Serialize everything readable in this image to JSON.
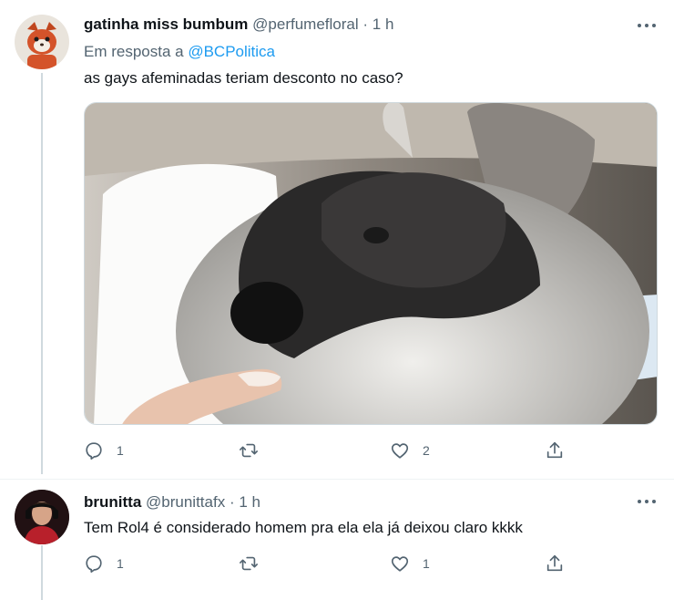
{
  "tweets": [
    {
      "display_name": "gatinha miss bumbum",
      "handle": "@perfumefloral",
      "separator": "·",
      "time": "1 h",
      "replying_prefix": "Em resposta a ",
      "replying_to": "@BCPolitica",
      "text": "as gays afeminadas teriam desconto no caso?",
      "has_media": true,
      "actions": {
        "reply_count": "1",
        "retweet_count": "",
        "like_count": "2"
      }
    },
    {
      "display_name": "brunitta",
      "handle": "@brunittafx",
      "separator": "·",
      "time": "1 h",
      "text": "Tem Rol4 é considerado homem pra ela ela já deixou claro kkkk",
      "actions": {
        "reply_count": "1",
        "retweet_count": "",
        "like_count": "1"
      }
    }
  ],
  "colors": {
    "accent": "#1d9bf0",
    "secondary_text": "#536471",
    "thread_line": "#cfd9de"
  },
  "icons": [
    "reply-icon",
    "retweet-icon",
    "like-icon",
    "share-icon",
    "more-icon"
  ]
}
